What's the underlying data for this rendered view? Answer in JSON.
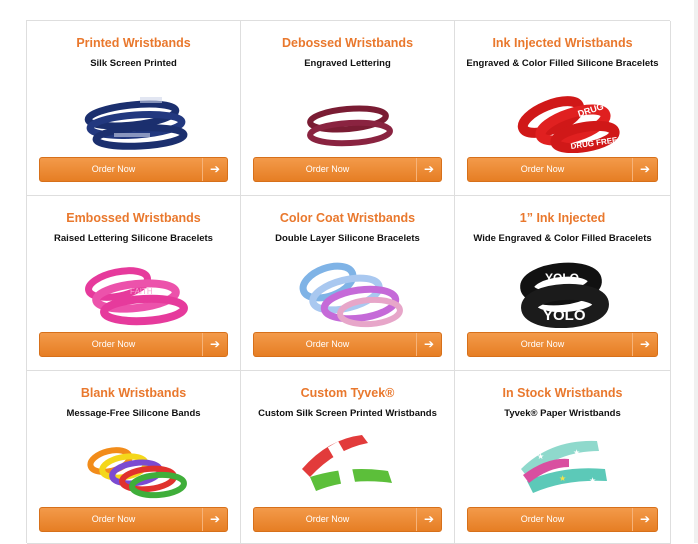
{
  "colors": {
    "accent": "#e9782d",
    "button": "#e67e24",
    "border": "#dedede"
  },
  "cards": [
    {
      "title": "Printed Wristbands",
      "subtitle": "Silk Screen Printed",
      "button": "Order Now",
      "image": "navy-printed-wristbands"
    },
    {
      "title": "Debossed Wristbands",
      "subtitle": "Engraved Lettering",
      "button": "Order Now",
      "image": "maroon-debossed-wristbands"
    },
    {
      "title": "Ink Injected Wristbands",
      "subtitle": "Engraved & Color Filled Silicone Bracelets",
      "button": "Order Now",
      "image": "red-ink-injected-wristbands",
      "band_text": "DRUG FREE"
    },
    {
      "title": "Embossed Wristbands",
      "subtitle": "Raised Lettering Silicone Bracelets",
      "button": "Order Now",
      "image": "pink-embossed-wristbands",
      "band_text": "FAITH"
    },
    {
      "title": "Color Coat Wristbands",
      "subtitle": "Double Layer Silicone Bracelets",
      "button": "Order Now",
      "image": "color-coat-wristbands"
    },
    {
      "title": "1” Ink Injected",
      "subtitle": "Wide Engraved & Color Filled Bracelets",
      "button": "Order Now",
      "image": "black-wide-wristbands",
      "band_text": "YOLO"
    },
    {
      "title": "Blank Wristbands",
      "subtitle": "Message-Free Silicone Bands",
      "button": "Order Now",
      "image": "multicolor-blank-wristbands"
    },
    {
      "title": "Custom Tyvek®",
      "subtitle": "Custom Silk Screen Printed Wristbands",
      "button": "Order Now",
      "image": "red-green-tyvek-wristbands"
    },
    {
      "title": "In Stock Wristbands",
      "subtitle": "Tyvek® Paper Wristbands",
      "button": "Order Now",
      "image": "teal-star-tyvek-wristbands"
    }
  ]
}
